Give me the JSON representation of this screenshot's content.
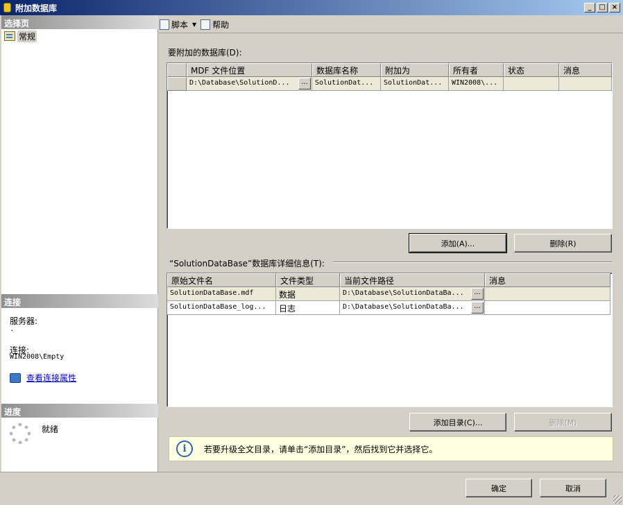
{
  "window": {
    "title": "附加数据库",
    "min_glyph": "_",
    "max_glyph": "□",
    "close_glyph": "×"
  },
  "left_panel": {
    "select_page_header": "选择页",
    "pages": [
      {
        "label": "常规",
        "icon": "properties-page-icon"
      }
    ],
    "connection_header": "连接",
    "server_label": "服务器:",
    "server_value": ".",
    "connection_label": "连接:",
    "connection_value": "WIN2008\\Empty",
    "view_connection_link": "查看连接属性",
    "progress_header": "进度",
    "progress_status": "就绪"
  },
  "toolbar": {
    "script_label": "脚本",
    "help_label": "帮助"
  },
  "attach_section": {
    "caption": "要附加的数据库(D):",
    "columns": [
      "MDF 文件位置",
      "数据库名称",
      "附加为",
      "所有者",
      "状态",
      "消息"
    ],
    "rows": [
      {
        "mdf": "D:\\Database\\SolutionD...",
        "ellipsis": "...",
        "db_name": "SolutionDat...",
        "attach_as": "SolutionDat...",
        "owner": "WIN2008\\...",
        "status": "",
        "message": ""
      }
    ],
    "add_button": "添加(A)...",
    "remove_button": "删除(R)"
  },
  "details_section": {
    "caption": "“SolutionDataBase”数据库详细信息(T):",
    "columns": [
      "原始文件名",
      "文件类型",
      "当前文件路径",
      "消息"
    ],
    "rows": [
      {
        "file": "SolutionDataBase.mdf",
        "type": "数据",
        "path": "D:\\Database\\SolutionDataBa...",
        "ellipsis": "...",
        "message": ""
      },
      {
        "file": "SolutionDataBase_log...",
        "type": "日志",
        "path": "D:\\Database\\SolutionDataBa...",
        "ellipsis": "...",
        "message": ""
      }
    ],
    "add_catalog_button": "添加目录(C)...",
    "remove_button": "删除(M)"
  },
  "info_bar": {
    "message": "若要升级全文目录，请单击“添加目录”，然后找到它并选择它。"
  },
  "footer": {
    "ok_button": "确定",
    "cancel_button": "取消"
  }
}
